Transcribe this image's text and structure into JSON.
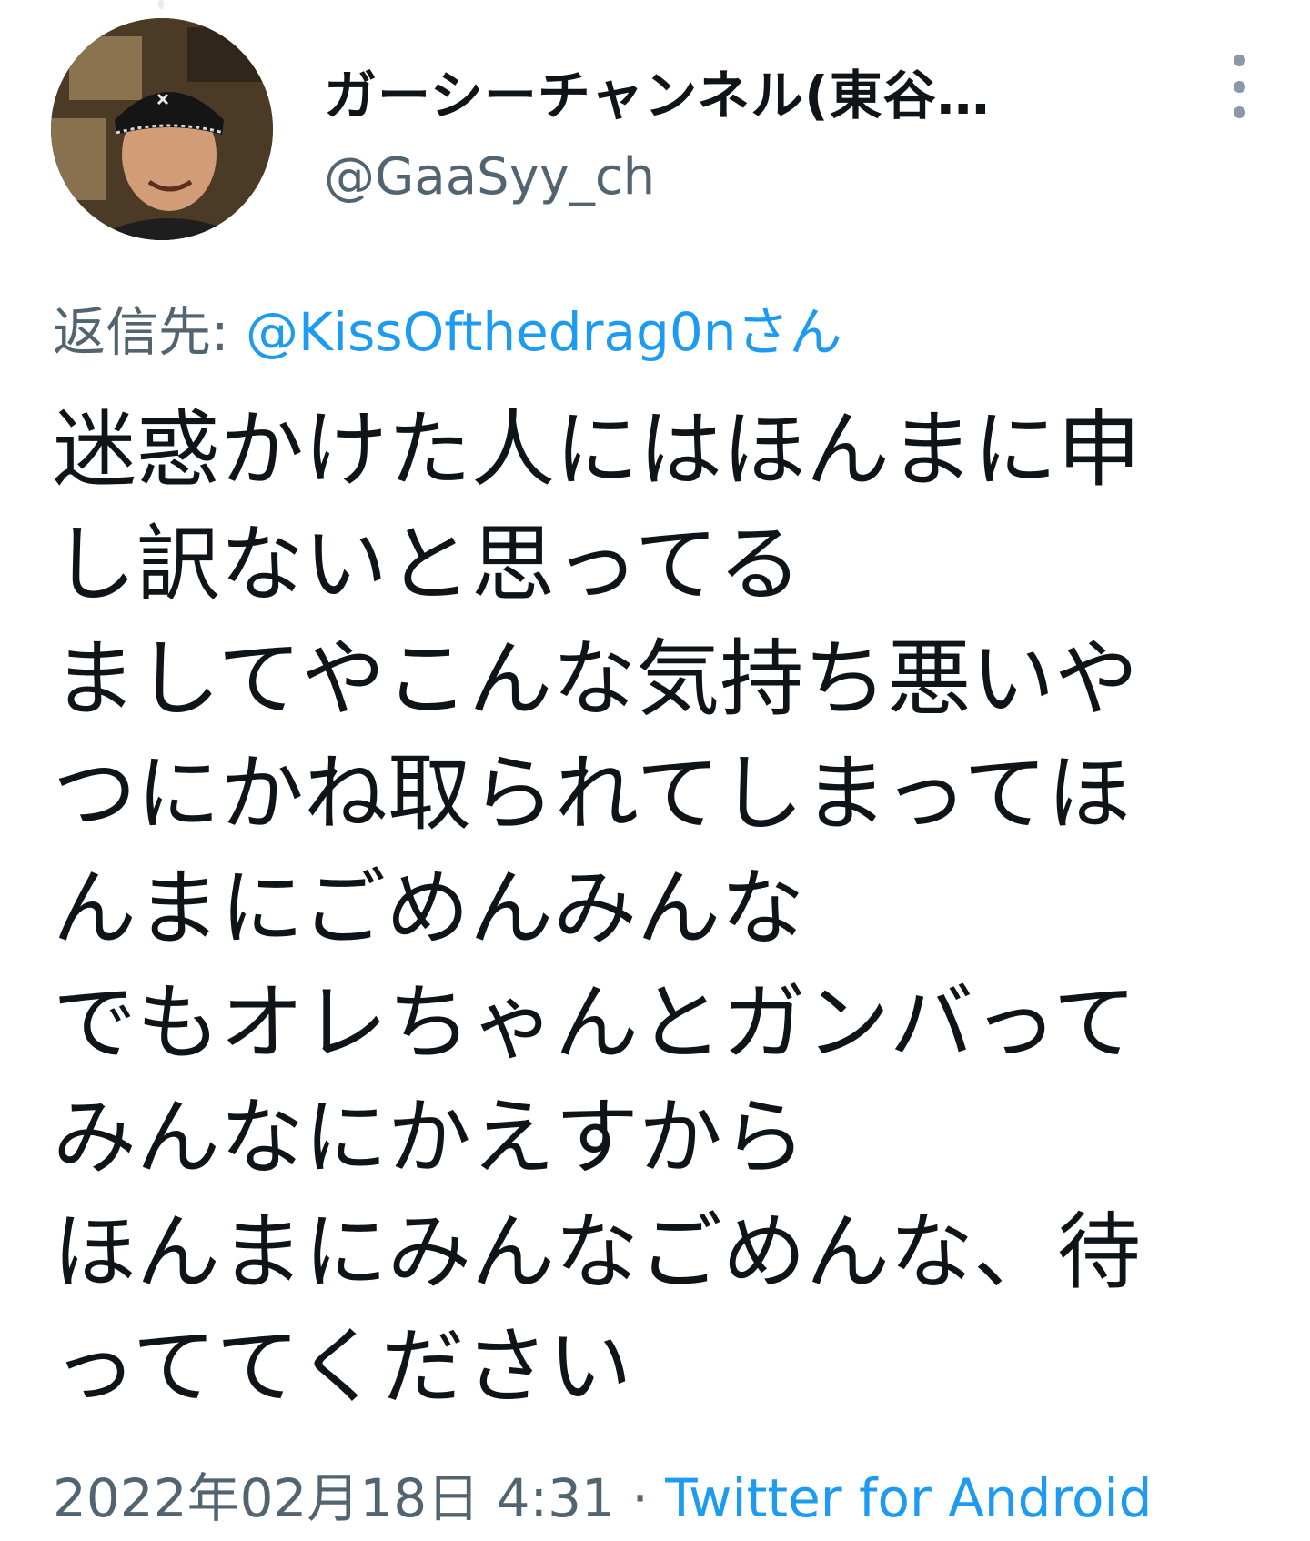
{
  "author": {
    "display_name": "ガーシーチャンネル(東谷…",
    "handle": "@GaaSyy_ch",
    "avatar_icon": "profile-photo"
  },
  "menu": {
    "icon": "more-vertical-icon"
  },
  "reply": {
    "label": "返信先: ",
    "target": "@KissOfthedrag0nさん"
  },
  "tweet": {
    "lines": [
      "迷惑かけた人にはほんまに申",
      "し訳ないと思ってる",
      "ましてやこんな気持ち悪いや",
      "つにかね取られてしまってほ",
      "んまにごめんみんな",
      "でもオレちゃんとガンバって",
      "みんなにかえすから",
      "ほんまにみんなごめんな、待",
      "っててください"
    ]
  },
  "meta": {
    "timestamp": "2022年02月18日 4:31",
    "separator": " · ",
    "source": "Twitter for Android"
  },
  "colors": {
    "text": "#0f1419",
    "secondary": "#536471",
    "link": "#1d9bf0"
  }
}
